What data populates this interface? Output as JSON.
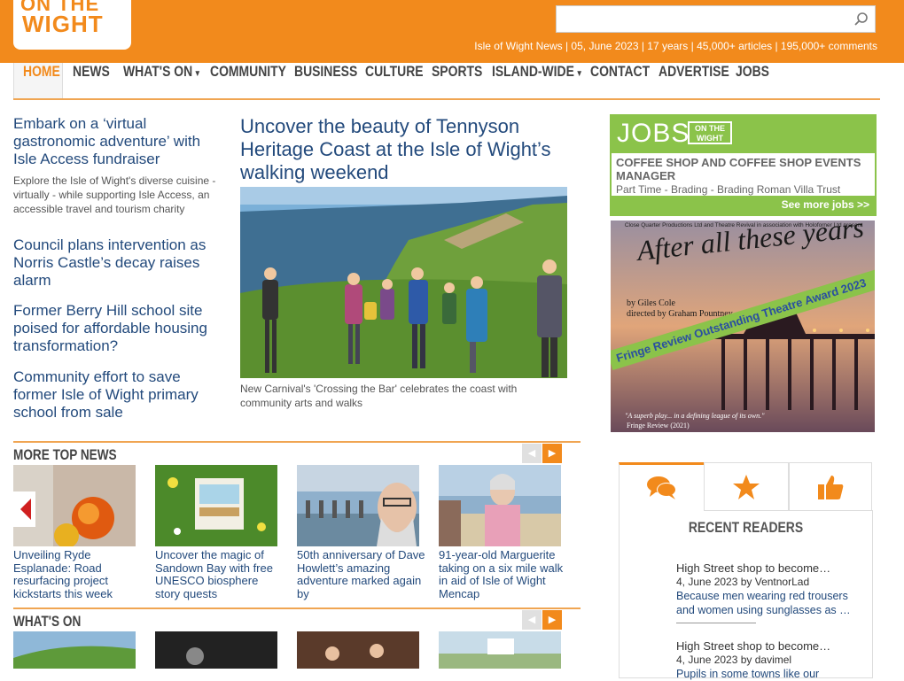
{
  "header": {
    "logo_on": "ON THE",
    "logo_wight": "WIGHT",
    "search_placeholder": "",
    "tagline": "Isle of Wight News | 05, June 2023 | 17 years | 45,000+ articles | 195,000+ comments",
    "brand_color": "#f28a1c"
  },
  "nav": {
    "items": [
      {
        "label": "HOME"
      },
      {
        "label": "NEWS"
      },
      {
        "label": "WHAT'S ON"
      },
      {
        "label": "COMMUNITY"
      },
      {
        "label": "BUSINESS"
      },
      {
        "label": "CULTURE"
      },
      {
        "label": "SPORTS"
      },
      {
        "label": "ISLAND-WIDE"
      },
      {
        "label": "CONTACT"
      },
      {
        "label": "ADVERTISE"
      },
      {
        "label": "JOBS"
      }
    ],
    "caret": "▼"
  },
  "left_stories": [
    {
      "title": "Embark on a ‘virtual gastronomic adventure’ with Isle Access fundraiser",
      "summary": "Explore the Isle of Wight's diverse cuisine - virtually - while supporting Isle Access, an accessible travel and tourism charity"
    },
    {
      "title": "Council plans intervention as Norris Castle’s decay raises alarm"
    },
    {
      "title": "Former Berry Hill school site poised for affordable housing transformation?"
    },
    {
      "title": "Community effort to save former Isle of Wight primary school from sale"
    }
  ],
  "main_story": {
    "title": "Uncover the beauty of Tennyson Heritage Coast at the Isle of Wight’s walking weekend",
    "caption": "New Carnival's 'Crossing the Bar' celebrates the coast with community arts and walks"
  },
  "jobs": {
    "logo": "JOBS",
    "badge_line1": "ON THE",
    "badge_line2": "WIGHT",
    "title": "COFFEE SHOP AND COFFEE SHOP EVENTS MANAGER",
    "sub": "Part Time - Brading - Brading Roman Villa Trust",
    "more": "See more jobs >>"
  },
  "ad": {
    "top": "Close Quarter Productions Ltd and Theatre Revival in association with Holoforner Ltd present",
    "title": "After all these years",
    "by": "by Giles Cole",
    "directed": "directed by Graham Pountney",
    "award": "Fringe Review Outstanding Theatre Award 2023",
    "quote": "\"A superb play... in a defining league of its own.\"",
    "source": "Fringe Review (2021)"
  },
  "more_top_news": {
    "title": "MORE TOP NEWS",
    "items": [
      {
        "title": "Unveiling Ryde Esplanade: Road resurfacing project kickstarts this week"
      },
      {
        "title": "Uncover the magic of Sandown Bay with free UNESCO biosphere story quests"
      },
      {
        "title": "50th anniversary of Dave Howlett’s amazing adventure marked again by"
      },
      {
        "title": "91-year-old Marguerite taking on a six mile walk in aid of Isle of Wight Mencap"
      }
    ]
  },
  "whats_on": {
    "title": "WHAT'S ON"
  },
  "arrows": {
    "prev": "◀",
    "next": "▶"
  },
  "sidebar_tabs": {
    "panel_title": "RECENT READERS",
    "readers": [
      {
        "title": "High Street shop to become…",
        "meta": "4, June 2023 by VentnorLad",
        "comment": "Because men wearing red trousers and women using sunglasses as …"
      },
      {
        "title": "High Street shop to become…",
        "meta": "4, June 2023 by davimel",
        "comment": "Pupils in some towns like our"
      }
    ]
  }
}
